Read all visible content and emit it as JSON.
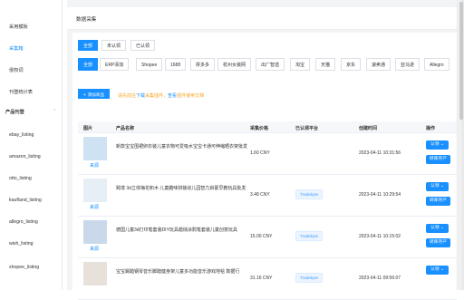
{
  "sidebar": {
    "items": [
      {
        "label": "采用模板",
        "active": false
      },
      {
        "label": "采集箱",
        "active": true
      },
      {
        "label": "侵权词",
        "active": false
      },
      {
        "label": "刊登统计表",
        "active": false
      }
    ],
    "section_title": "产品刊登",
    "listing_items": [
      {
        "label": "ebay_listing"
      },
      {
        "label": "amazon_listing"
      },
      {
        "label": "otto_listing"
      },
      {
        "label": "kaufland_listing"
      },
      {
        "label": "allegro_listing"
      },
      {
        "label": "wish_listing"
      },
      {
        "label": "shopee_listing"
      }
    ]
  },
  "header": {
    "title": "数据采集"
  },
  "filter_tabs": [
    {
      "label": "全部",
      "active": true
    },
    {
      "label": "未认领",
      "active": false
    },
    {
      "label": "已认领",
      "active": false
    }
  ],
  "source_tabs": [
    {
      "label": "全部",
      "active": true
    },
    {
      "label": "ERP添加",
      "active": false
    },
    {
      "label": "Shopee",
      "active": false
    },
    {
      "label": "1688",
      "active": false
    },
    {
      "label": "拼多多",
      "active": false
    },
    {
      "label": "杭州女装网",
      "active": false
    },
    {
      "label": "出厂智选",
      "active": false
    },
    {
      "label": "淘宝",
      "active": false
    },
    {
      "label": "天猫",
      "active": false
    },
    {
      "label": "京东",
      "active": false
    },
    {
      "label": "速卖通",
      "active": false
    },
    {
      "label": "亚马逊",
      "active": false
    },
    {
      "label": "Allegro",
      "active": false
    }
  ],
  "toolbar": {
    "add_button": "添加商品",
    "note_prefix": "请先前往",
    "note_link1": "下载",
    "note_mid": "采集插件，",
    "note_link2": "查看",
    "note_suffix": "插件使用文档"
  },
  "table": {
    "headers": [
      "图片",
      "产品名称",
      "采集价格",
      "已认领平台",
      "创建时间",
      "操作"
    ],
    "rows": [
      {
        "source": "来源",
        "name": "新款宝宝围裙卵衣装儿童衣物可爱吸水宝宝卡通可伸缩晒衣架批发",
        "price": "1.60 CNY",
        "platform": "",
        "time": "2023-04-11 10:31:56",
        "claim": "认领",
        "edit": "转库存产"
      },
      {
        "source": "来源",
        "name": "跨境 3d立体梅花积木 儿童趣味拼装幼儿园智力启蒙早教玩具批发",
        "price": "3.48 CNY",
        "platform": "Tradebyte",
        "time": "2023-04-11 10:29:54",
        "claim": "认领",
        "edit": "转库存产"
      },
      {
        "source": "来源",
        "name": "德国儿童3d打印笔套装DIY玩具蜡烛涂鸦笔套装儿童创意玩具",
        "price": "15.00 CNY",
        "platform": "Tradebyte",
        "time": "2023-04-11 10:15:02",
        "claim": "认领",
        "edit": "转库存产"
      },
      {
        "source": "来源",
        "name": "宝宝踢踏钢琴音乐脚踏健身架儿童多功能音乐游戏地毯 数据行",
        "price": "31.16 CNY",
        "platform": "Tradebyte",
        "time": "2023-04-11 09:56:07",
        "claim": "认领",
        "edit": "转库存产"
      }
    ]
  },
  "colors": {
    "accent": "#1890ff",
    "warning": "#f5a623"
  },
  "icons": {
    "chevron": "chevron-down-icon",
    "add": "plus-icon"
  }
}
